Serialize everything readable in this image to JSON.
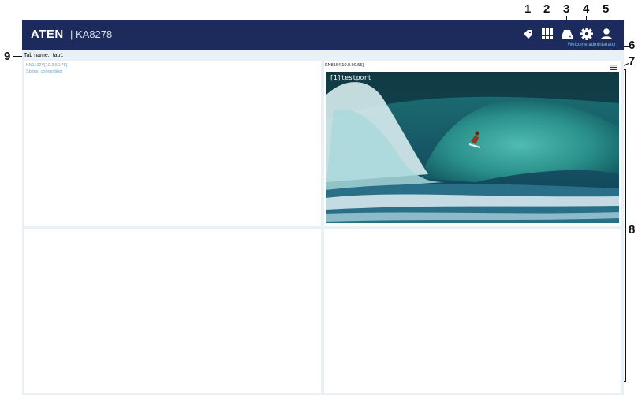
{
  "app": {
    "brand": "ATEN",
    "model": "| KA8278",
    "welcome": "Welcome administrator"
  },
  "header_icons": [
    "tag-icon",
    "grid-icon",
    "drive-icon",
    "gear-icon",
    "user-icon"
  ],
  "tab": {
    "label": "Tab name:",
    "value": "tab1"
  },
  "panels": [
    {
      "title": "KN1132V[10.3.50.75]",
      "status": "Status: connecting"
    },
    {
      "title": "KN8164[10.0.90.55]",
      "port": "[1]testport"
    },
    {
      "title": ""
    },
    {
      "title": ""
    }
  ],
  "callouts": [
    "1",
    "2",
    "3",
    "4",
    "5",
    "6",
    "7",
    "8",
    "9"
  ],
  "colors": {
    "header_bg": "#1c2b5c",
    "page_bg": "#e9f1f6",
    "accent_text": "#6aa7d8",
    "welcome_text": "#7fc4ff"
  }
}
